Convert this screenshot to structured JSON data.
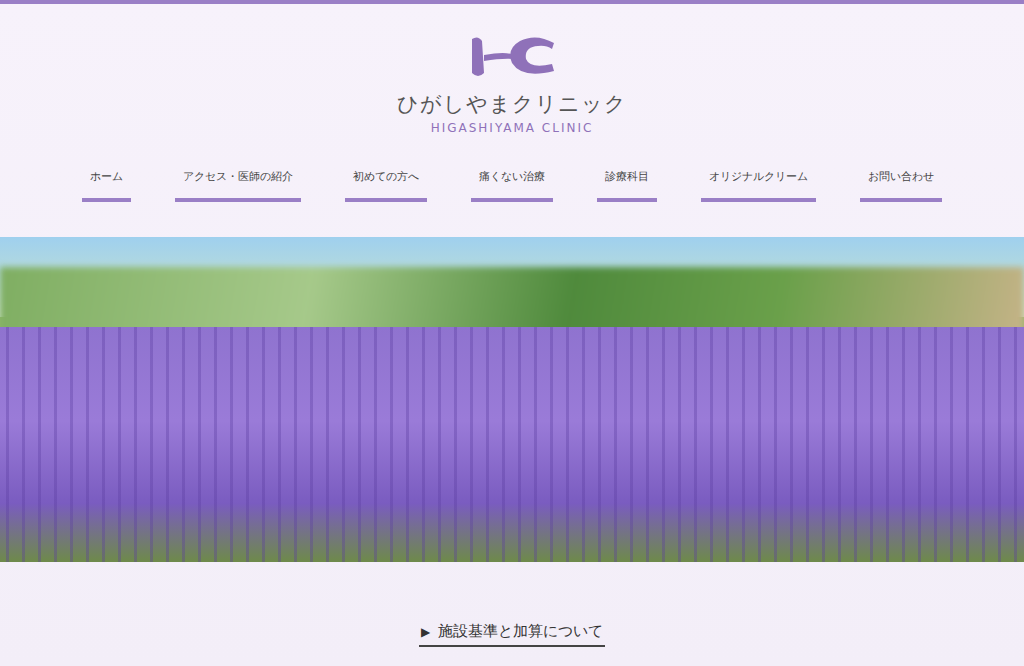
{
  "header": {
    "name_ja": "ひがしやまクリニック",
    "name_en": "HIGASHIYAMA CLINIC"
  },
  "nav": [
    {
      "label": "ホーム"
    },
    {
      "label": "アクセス・医師の紹介"
    },
    {
      "label": "初めての方へ"
    },
    {
      "label": "痛くない治療"
    },
    {
      "label": "診療科目"
    },
    {
      "label": "オリジナルクリーム"
    },
    {
      "label": "お問い合わせ"
    }
  ],
  "hero": {
    "kind": "photo"
  },
  "notice_link": {
    "icon": "▶",
    "label": "施設基準と加算について"
  }
}
